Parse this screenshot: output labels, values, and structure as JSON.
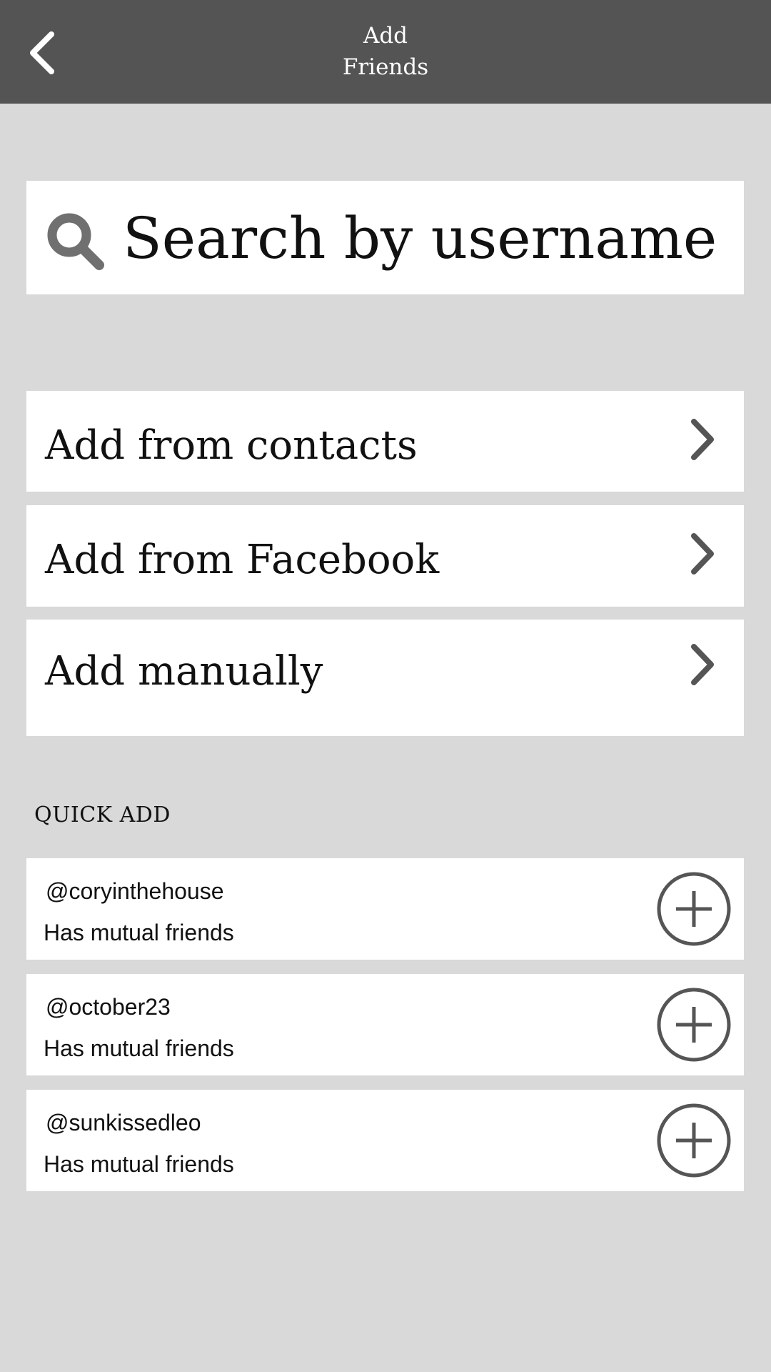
{
  "header": {
    "title": "Add Friends",
    "back_icon": "chevron-left-icon"
  },
  "search": {
    "placeholder": "Search by username",
    "icon": "search-icon"
  },
  "options": [
    {
      "label": "Add from contacts",
      "icon": "chevron-right-icon"
    },
    {
      "label": "Add from Facebook",
      "icon": "chevron-right-icon"
    },
    {
      "label": "Add manually",
      "icon": "chevron-right-icon"
    }
  ],
  "quick_add": {
    "title": "QUICK ADD",
    "users": [
      {
        "username": "@coryinthehouse",
        "subtitle": "Has mutual friends",
        "icon": "plus-circle-icon"
      },
      {
        "username": "@october23",
        "subtitle": "Has mutual friends",
        "icon": "plus-circle-icon"
      },
      {
        "username": "@sunkissedleo",
        "subtitle": "Has mutual friends",
        "icon": "plus-circle-icon"
      }
    ]
  },
  "colors": {
    "header_bg": "#545454",
    "page_bg": "#d9d9d9",
    "card_bg": "#ffffff",
    "icon": "#555555"
  }
}
